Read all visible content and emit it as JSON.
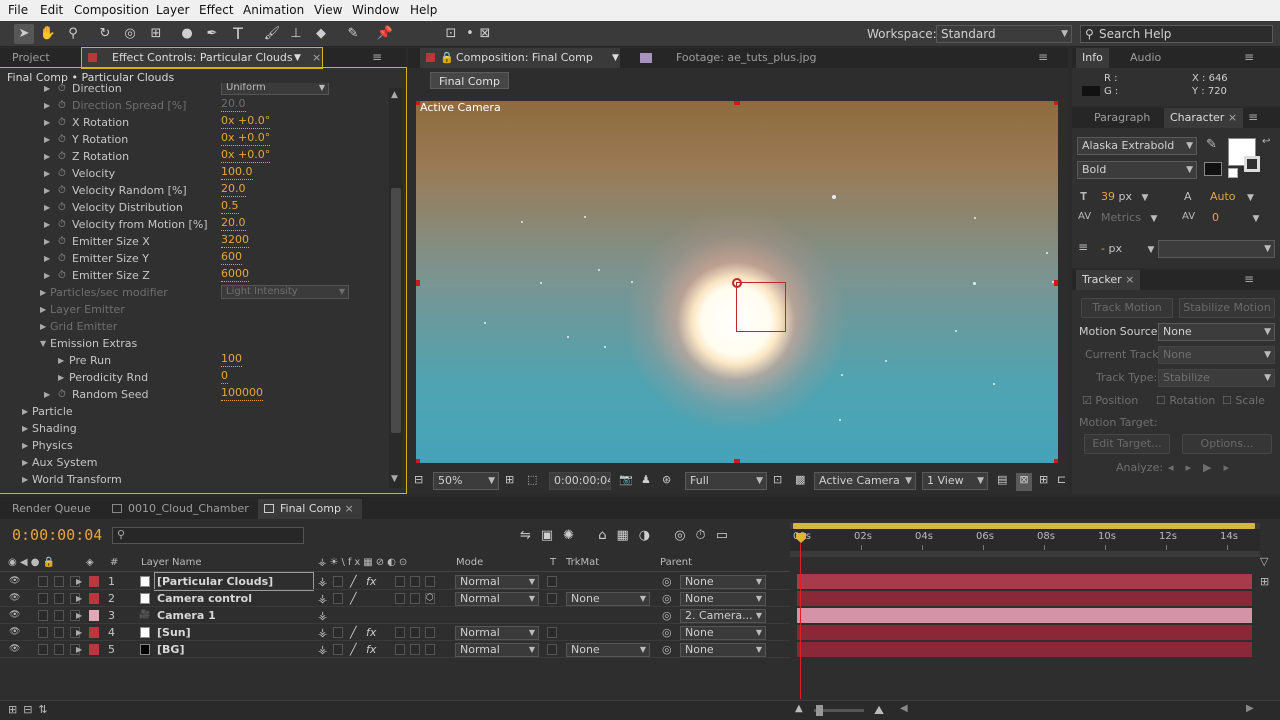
{
  "menu": [
    "File",
    "Edit",
    "Composition",
    "Layer",
    "Effect",
    "Animation",
    "View",
    "Window",
    "Help"
  ],
  "toolbar": {
    "workspace_label": "Workspace:",
    "workspace_value": "Standard",
    "search_placeholder": "Search Help"
  },
  "effect_panel": {
    "tab_project": "Project",
    "tab_title": "Effect Controls: Particular Clouds",
    "breadcrumb": "Final Comp • Particular Clouds",
    "rows": [
      {
        "name": "Direction",
        "value": "Uniform",
        "indent": 2,
        "dim": false
      },
      {
        "name": "Direction Spread [%]",
        "value": "20.0",
        "indent": 2,
        "dim": true
      },
      {
        "name": "X Rotation",
        "value": "0x +0.0°",
        "indent": 2,
        "dim": false
      },
      {
        "name": "Y Rotation",
        "value": "0x +0.0°",
        "indent": 2,
        "dim": false
      },
      {
        "name": "Z Rotation",
        "value": "0x +0.0°",
        "indent": 2,
        "dim": false
      },
      {
        "name": "Velocity",
        "value": "100.0",
        "indent": 2,
        "dim": false
      },
      {
        "name": "Velocity Random [%]",
        "value": "20.0",
        "indent": 2,
        "dim": false
      },
      {
        "name": "Velocity Distribution",
        "value": "0.5",
        "indent": 2,
        "dim": false
      },
      {
        "name": "Velocity from Motion [%]",
        "value": "20.0",
        "indent": 2,
        "dim": false
      },
      {
        "name": "Emitter Size X",
        "value": "3200",
        "indent": 2,
        "dim": false
      },
      {
        "name": "Emitter Size Y",
        "value": "600",
        "indent": 2,
        "dim": false
      },
      {
        "name": "Emitter Size Z",
        "value": "6000",
        "indent": 2,
        "dim": false
      },
      {
        "name": "Particles/sec modifier",
        "value": "Light Intensity",
        "indent": 1,
        "dim": true
      },
      {
        "name": "Layer Emitter",
        "value": "",
        "indent": 1,
        "dim": true
      },
      {
        "name": "Grid Emitter",
        "value": "",
        "indent": 1,
        "dim": true
      },
      {
        "name": "Emission Extras",
        "value": "",
        "indent": 1,
        "dim": false
      },
      {
        "name": "Pre Run",
        "value": "100",
        "indent": 3,
        "dim": false
      },
      {
        "name": "Perodicity Rnd",
        "value": "0",
        "indent": 3,
        "dim": false
      },
      {
        "name": "Random Seed",
        "value": "100000",
        "indent": 2,
        "dim": false
      },
      {
        "name": "Particle",
        "value": "",
        "indent": 0,
        "dim": false
      },
      {
        "name": "Shading",
        "value": "",
        "indent": 0,
        "dim": false
      },
      {
        "name": "Physics",
        "value": "",
        "indent": 0,
        "dim": false
      },
      {
        "name": "Aux System",
        "value": "",
        "indent": 0,
        "dim": false
      },
      {
        "name": "World Transform",
        "value": "",
        "indent": 0,
        "dim": false
      }
    ]
  },
  "composition": {
    "tab_title": "Composition: Final Comp",
    "footage_tab": "Footage: ae_tuts_plus.jpg",
    "subtab": "Final Comp",
    "camera_label": "Active Camera",
    "zoom": "50%",
    "timecode": "0:00:00:04",
    "resolution": "Full",
    "view_camera": "Active Camera",
    "view_count": "1 View"
  },
  "info": {
    "tab_info": "Info",
    "tab_audio": "Audio",
    "r_label": "R :",
    "g_label": "G :",
    "x_label": "X : 646",
    "y_label": "Y : 720"
  },
  "character": {
    "tab_paragraph": "Paragraph",
    "tab_character": "Character",
    "font": "Alaska Extrabold",
    "style": "Bold",
    "size": "39",
    "size_unit": "px",
    "leading": "Auto",
    "kerning": "Metrics",
    "tracking": "0",
    "stroke_width": "-",
    "stroke_unit": "px"
  },
  "tracker": {
    "tab": "Tracker",
    "track_motion": "Track Motion",
    "stabilize_motion": "Stabilize Motion",
    "motion_source_label": "Motion Source:",
    "motion_source": "None",
    "current_track_label": "Current Track:",
    "current_track": "None",
    "track_type_label": "Track Type:",
    "track_type": "Stabilize",
    "position": "Position",
    "rotation": "Rotation",
    "scale": "Scale",
    "motion_target": "Motion Target:",
    "edit_target": "Edit Target...",
    "options": "Options...",
    "analyze": "Analyze:"
  },
  "timeline": {
    "tabs": [
      "Render Queue",
      "0010_Cloud_Chamber",
      "Final Comp"
    ],
    "timecode": "0:00:00:04",
    "columns": {
      "num": "#",
      "layer_name": "Layer Name",
      "mode": "Mode",
      "t": "T",
      "trkmat": "TrkMat",
      "parent": "Parent"
    },
    "ruler": [
      "00s",
      "02s",
      "04s",
      "06s",
      "08s",
      "10s",
      "12s",
      "14s"
    ],
    "layers": [
      {
        "num": "1",
        "name": "[Particular Clouds]",
        "label_color": "#b8383f",
        "icon": "solid-white",
        "mode": "Normal",
        "trkmat": "",
        "parent": "None",
        "fx": true,
        "bar_color": "#a83a4c"
      },
      {
        "num": "2",
        "name": "Camera control",
        "label_color": "#b8383f",
        "icon": "solid-white",
        "mode": "Normal",
        "trkmat": "None",
        "parent": "None",
        "fx": false,
        "bar_color": "#8a2838"
      },
      {
        "num": "3",
        "name": "Camera 1",
        "label_color": "#e3a8b8",
        "icon": "camera",
        "mode": "",
        "trkmat": "",
        "parent": "2. Camera...",
        "fx": false,
        "bar_color": "#d493a6"
      },
      {
        "num": "4",
        "name": "[Sun]",
        "label_color": "#b8383f",
        "icon": "solid-white",
        "mode": "Normal",
        "trkmat": "",
        "parent": "None",
        "fx": true,
        "bar_color": "#8a2838"
      },
      {
        "num": "5",
        "name": "[BG]",
        "label_color": "#b8383f",
        "icon": "solid-black",
        "mode": "Normal",
        "trkmat": "None",
        "parent": "None",
        "fx": true,
        "bar_color": "#8a2838"
      }
    ]
  }
}
